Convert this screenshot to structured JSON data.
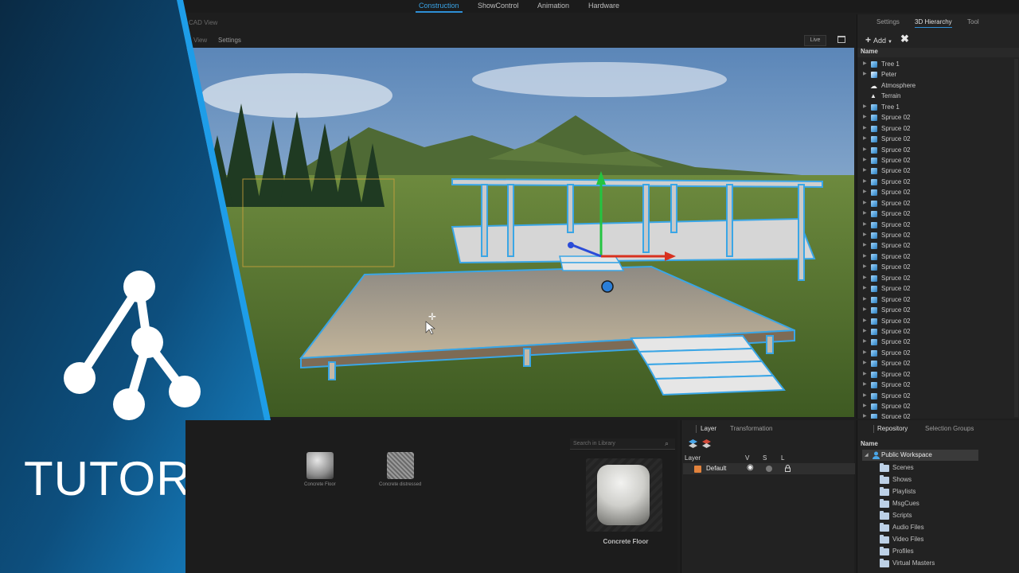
{
  "top_nav": {
    "tabs": [
      "Construction",
      "ShowControl",
      "Animation",
      "Hardware"
    ],
    "active": "Construction"
  },
  "cad_view": {
    "title": "CAD View",
    "menu_view": "View",
    "menu_settings": "Settings",
    "live_label": "Live"
  },
  "hierarchy": {
    "tabs": [
      "Settings",
      "3D Hierarchy",
      "Tool"
    ],
    "active_tab": "3D Hierarchy",
    "add_label": "Add",
    "name_header": "Name",
    "items": [
      {
        "label": "Tree 1",
        "icon": "cube-icon",
        "expandable": true
      },
      {
        "label": "Peter",
        "icon": "person-cube-icon",
        "expandable": true
      },
      {
        "label": "Atmosphere",
        "icon": "atmosphere-icon",
        "expandable": false
      },
      {
        "label": "Terrain",
        "icon": "terrain-icon",
        "expandable": false
      },
      {
        "label": "Tree 1",
        "icon": "cube-icon",
        "expandable": true
      },
      {
        "label": "Spruce 02",
        "icon": "cube-icon",
        "expandable": true
      },
      {
        "label": "Spruce 02",
        "icon": "cube-icon",
        "expandable": true
      },
      {
        "label": "Spruce 02",
        "icon": "cube-icon",
        "expandable": true
      },
      {
        "label": "Spruce 02",
        "icon": "cube-icon",
        "expandable": true
      },
      {
        "label": "Spruce 02",
        "icon": "cube-icon",
        "expandable": true
      },
      {
        "label": "Spruce 02",
        "icon": "cube-icon",
        "expandable": true
      },
      {
        "label": "Spruce 02",
        "icon": "cube-icon",
        "expandable": true
      },
      {
        "label": "Spruce 02",
        "icon": "cube-icon",
        "expandable": true
      },
      {
        "label": "Spruce 02",
        "icon": "cube-icon",
        "expandable": true
      },
      {
        "label": "Spruce 02",
        "icon": "cube-icon",
        "expandable": true
      },
      {
        "label": "Spruce 02",
        "icon": "cube-icon",
        "expandable": true
      },
      {
        "label": "Spruce 02",
        "icon": "cube-icon",
        "expandable": true
      },
      {
        "label": "Spruce 02",
        "icon": "cube-icon",
        "expandable": true
      },
      {
        "label": "Spruce 02",
        "icon": "cube-icon",
        "expandable": true
      },
      {
        "label": "Spruce 02",
        "icon": "cube-icon",
        "expandable": true
      },
      {
        "label": "Spruce 02",
        "icon": "cube-icon",
        "expandable": true
      },
      {
        "label": "Spruce 02",
        "icon": "cube-icon",
        "expandable": true
      },
      {
        "label": "Spruce 02",
        "icon": "cube-icon",
        "expandable": true
      },
      {
        "label": "Spruce 02",
        "icon": "cube-icon",
        "expandable": true
      },
      {
        "label": "Spruce 02",
        "icon": "cube-icon",
        "expandable": true
      },
      {
        "label": "Spruce 02",
        "icon": "cube-icon",
        "expandable": true
      },
      {
        "label": "Spruce 02",
        "icon": "cube-icon",
        "expandable": true
      },
      {
        "label": "Spruce 02",
        "icon": "cube-icon",
        "expandable": true
      },
      {
        "label": "Spruce 02",
        "icon": "cube-icon",
        "expandable": true
      },
      {
        "label": "Spruce 02",
        "icon": "cube-icon",
        "expandable": true
      },
      {
        "label": "Spruce 02",
        "icon": "cube-icon",
        "expandable": true
      },
      {
        "label": "Spruce 02",
        "icon": "cube-icon",
        "expandable": true
      },
      {
        "label": "Spruce 02",
        "icon": "cube-icon",
        "expandable": true
      },
      {
        "label": "Spruce 02",
        "icon": "cube-icon",
        "expandable": true
      }
    ]
  },
  "library": {
    "search_placeholder": "Search in Library",
    "tiles": [
      {
        "label": "Concrete Floor"
      },
      {
        "label": "Concrete distressed"
      }
    ],
    "preview_label": "Concrete Floor"
  },
  "layer_panel": {
    "tabs": [
      "Layer",
      "Transformation"
    ],
    "active_tab": "Layer",
    "headers": {
      "layer": "Layer",
      "v": "V",
      "s": "S",
      "l": "L"
    },
    "rows": [
      {
        "name": "Default",
        "color": "#e2833d"
      }
    ]
  },
  "repository": {
    "tabs": [
      "Repository",
      "Selection Groups"
    ],
    "active_tab": "Repository",
    "name_header": "Name",
    "workspace": "Public Workspace",
    "folders": [
      "Scenes",
      "Shows",
      "Playlists",
      "MsgCues",
      "Scripts",
      "Audio Files",
      "Video Files",
      "Profiles",
      "Virtual Masters"
    ]
  },
  "branding": {
    "overlay_text": "TUTORIAL",
    "accent": "#1f8fd8"
  }
}
